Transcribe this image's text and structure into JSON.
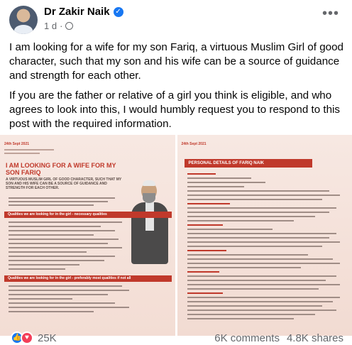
{
  "post": {
    "author": "Dr Zakir Naik",
    "time": "1 d",
    "privacy_icon": "globe-icon",
    "paragraph1": "I am looking for a wife for my son Fariq, a virtuous Muslim Girl of good character, such that my son and his wife can be a source of guidance and strength for each other.",
    "paragraph2": "If you are the father or relative of a girl you think is eligible, and who agrees to look into this, I would humbly request you to respond to this post with the required information."
  },
  "images": {
    "left": {
      "date": "24th Sept 2021",
      "title": "I AM LOOKING FOR A WIFE FOR MY SON FARIQ",
      "subtitle": "A VIRTUOUS MUSLIM GIRL OF GOOD CHARACTER, SUCH THAT MY SON AND HIS WIFE CAN BE A SOURCE OF GUIDANCE AND STRENGTH FOR EACH OTHER.",
      "section1": "Qualities we are looking for in the girl - necessary qualities",
      "section2": "Qualities we are looking for in the girl - preferably most qualities if not all"
    },
    "right": {
      "date": "24th Sept 2021",
      "title": "PERSONAL DETAILS OF FARIQ NAIK"
    }
  },
  "footer": {
    "reaction_count": "25K",
    "comments": "6K comments",
    "shares": "4.8K shares"
  },
  "colors": {
    "accent": "#1877f2",
    "love": "#f33e58",
    "poster_red": "#c0392b"
  }
}
